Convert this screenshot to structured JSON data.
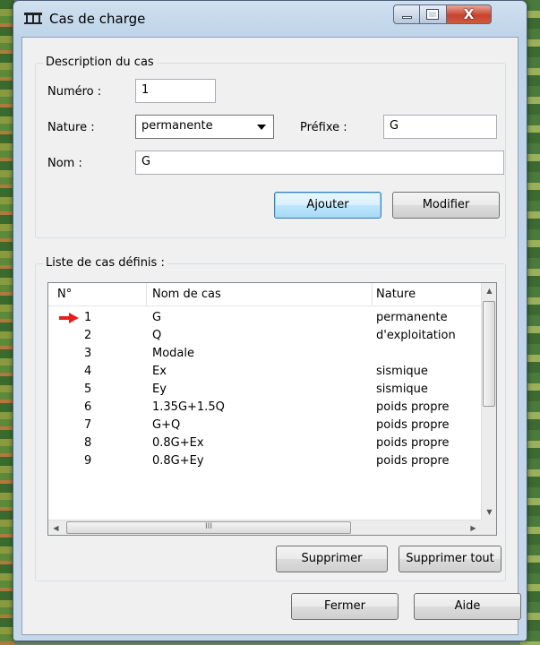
{
  "window": {
    "title": "Cas de charge",
    "min_glyph": "",
    "max_glyph": "",
    "close_glyph": "X"
  },
  "description": {
    "legend": "Description du cas",
    "numero_label": "Numéro :",
    "numero_value": "1",
    "nature_label": "Nature :",
    "nature_value": "permanente",
    "prefixe_label": "Préfixe :",
    "prefixe_value": "G",
    "nom_label": "Nom :",
    "nom_value": "G",
    "ajouter_label": "Ajouter",
    "modifier_label": "Modifier"
  },
  "liste": {
    "legend": "Liste de cas définis :",
    "columns": [
      "N°",
      "Nom de cas",
      "Nature"
    ],
    "rows": [
      {
        "num": "1",
        "nom": "G",
        "nature": "permanente",
        "selected": true
      },
      {
        "num": "2",
        "nom": "Q",
        "nature": "d'exploitation"
      },
      {
        "num": "3",
        "nom": "Modale",
        "nature": ""
      },
      {
        "num": "4",
        "nom": "Ex",
        "nature": "sismique"
      },
      {
        "num": "5",
        "nom": "Ey",
        "nature": "sismique"
      },
      {
        "num": "6",
        "nom": "1.35G+1.5Q",
        "nature": "poids propre"
      },
      {
        "num": "7",
        "nom": "G+Q",
        "nature": "poids propre"
      },
      {
        "num": "8",
        "nom": "0.8G+Ex",
        "nature": "poids propre"
      },
      {
        "num": "9",
        "nom": "0.8G+Ey",
        "nature": "poids propre"
      }
    ],
    "hscroll_grip": "III",
    "supprimer_label": "Supprimer",
    "supprimer_tout_label": "Supprimer tout"
  },
  "footer": {
    "fermer_label": "Fermer",
    "aide_label": "Aide"
  },
  "icons": {
    "app": "beam-structure-icon",
    "current_row": "red-arrow-icon"
  },
  "colors": {
    "accent_close": "#c8432c",
    "marker": "#e8201a",
    "default_button_border": "#3c7fb1"
  }
}
